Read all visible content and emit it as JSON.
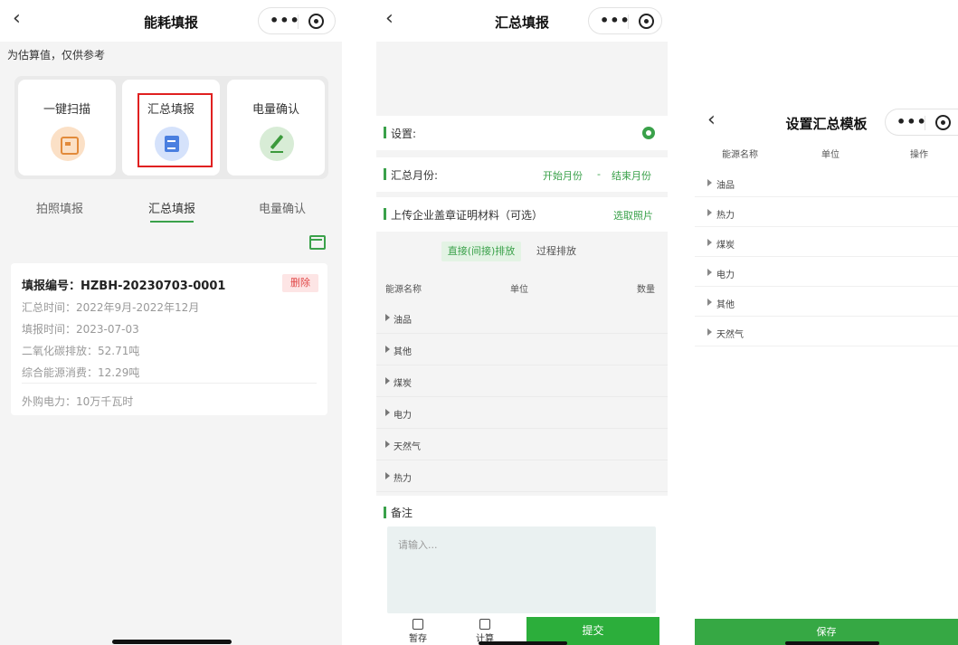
{
  "colors": {
    "accent": "#3aa14a",
    "highlight": "#e02020",
    "delete": "#e14848"
  },
  "screen1": {
    "back_icon": "‹",
    "title": "能耗填报",
    "notice": "为估算值，仅供参考",
    "cards": [
      {
        "label": "一键扫描",
        "icon": "scan-icon"
      },
      {
        "label": "汇总填报",
        "icon": "document-edit-icon"
      },
      {
        "label": "电量确认",
        "icon": "pen-sign-icon"
      }
    ],
    "tabs": [
      "拍照填报",
      "汇总填报",
      "电量确认"
    ],
    "active_tab": "汇总填报",
    "record": {
      "number": "填报编号：HZBH-20230703-0001",
      "delete_label": "删除",
      "summary_time": "汇总时间：2022年9月-2022年12月",
      "fill_time": "填报时间：2023-07-03",
      "co2": "二氧化碳排放：52.71吨",
      "energy": "综合能源消费：12.29吨",
      "electricity": "外购电力：10万千瓦时"
    }
  },
  "screen2": {
    "back_icon": "‹",
    "title": "汇总填报",
    "settings_label": "设置:",
    "month_label": "汇总月份:",
    "start_month": "开始月份",
    "month_separator": "-",
    "end_month": "结束月份",
    "upload_label": "上传企业盖章证明材料（可选）",
    "upload_action": "选取照片",
    "emission_tabs": [
      "直接(间接)排放",
      "过程排放"
    ],
    "columns": [
      "能源名称",
      "单位",
      "数量"
    ],
    "rows": [
      "油品",
      "其他",
      "煤炭",
      "电力",
      "天然气",
      "热力"
    ],
    "remark_label": "备注",
    "remark_placeholder": "请输入...",
    "draft_label": "暂存",
    "calc_label": "计算",
    "submit_label": "提交"
  },
  "screen3": {
    "back_icon": "‹",
    "title": "设置汇总模板",
    "columns": [
      "能源名称",
      "单位",
      "操作"
    ],
    "rows": [
      "油品",
      "热力",
      "煤炭",
      "电力",
      "其他",
      "天然气"
    ],
    "save_label": "保存"
  }
}
